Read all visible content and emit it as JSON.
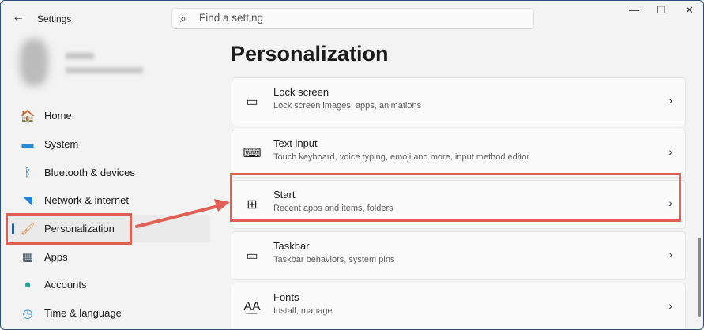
{
  "window": {
    "title": "Settings",
    "minimize": "—",
    "maximize": "☐",
    "close": "✕"
  },
  "search": {
    "placeholder": "Find a setting"
  },
  "nav": [
    {
      "label": "Home",
      "icon": "home-icon",
      "glyph": "🏠",
      "color": "#e08a3a"
    },
    {
      "label": "System",
      "icon": "system-icon",
      "glyph": "▬",
      "color": "#2a8ad4"
    },
    {
      "label": "Bluetooth & devices",
      "icon": "bluetooth-icon",
      "glyph": "ᛒ",
      "color": "#1e7fe0"
    },
    {
      "label": "Network & internet",
      "icon": "wifi-icon",
      "glyph": "◥",
      "color": "#1e7fe0"
    },
    {
      "label": "Personalization",
      "icon": "brush-icon",
      "glyph": "🖌",
      "color": "#e0893a",
      "selected": true
    },
    {
      "label": "Apps",
      "icon": "apps-icon",
      "glyph": "▦",
      "color": "#3a4b60"
    },
    {
      "label": "Accounts",
      "icon": "accounts-icon",
      "glyph": "●",
      "color": "#27a59a"
    },
    {
      "label": "Time & language",
      "icon": "time-language-icon",
      "glyph": "◷",
      "color": "#2a8ad4"
    }
  ],
  "page": {
    "title": "Personalization"
  },
  "cards": [
    {
      "title": "Lock screen",
      "subtitle": "Lock screen images, apps, animations",
      "icon": "lock-screen-icon",
      "glyph": "▭"
    },
    {
      "title": "Text input",
      "subtitle": "Touch keyboard, voice typing, emoji and more, input method editor",
      "icon": "keyboard-icon",
      "glyph": "⌨"
    },
    {
      "title": "Start",
      "subtitle": "Recent apps and items, folders",
      "icon": "start-icon",
      "glyph": "⊞"
    },
    {
      "title": "Taskbar",
      "subtitle": "Taskbar behaviors, system pins",
      "icon": "taskbar-icon",
      "glyph": "▭"
    },
    {
      "title": "Fonts",
      "subtitle": "Install, manage",
      "icon": "fonts-icon",
      "glyph": "A͟A"
    }
  ],
  "chevron": "›",
  "annotation_color": "#e06055"
}
